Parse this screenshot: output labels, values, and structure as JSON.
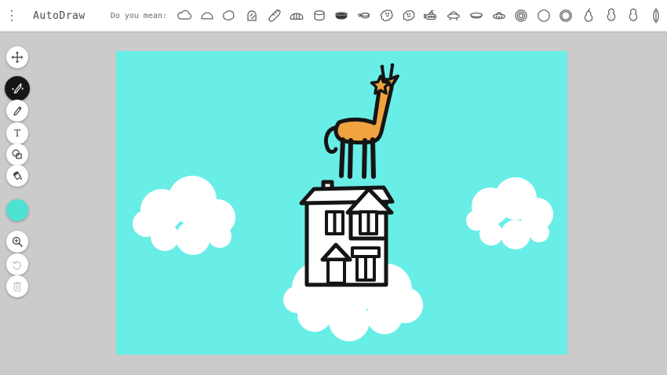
{
  "colors": {
    "topbar_bg": "#FFFFFF",
    "app_bg": "#CBCBCB",
    "canvas": "#69EDE7",
    "outline": "#151515",
    "giraffe": "#F1A33F",
    "cloud": "#FFFFFF",
    "swatch": "#4DE3D2",
    "icon": "#3F3F3F",
    "icon_disabled": "#C4C4C4",
    "suggestion_icon": "#5C5C5C"
  },
  "topbar": {
    "title": "AutoDraw",
    "prompt": "Do you mean:",
    "suggestions": [
      "cloud",
      "cloud-dome",
      "cloud-blob",
      "toast",
      "baguette",
      "bread-roll",
      "cylinder",
      "pot",
      "pan",
      "scribble-creature",
      "scribble-creature-2",
      "submarine",
      "ufo",
      "flying-saucer",
      "spaceship",
      "donut",
      "circle",
      "ring",
      "pear",
      "peanut",
      "peanut-outline",
      "surfboard"
    ]
  },
  "sidebar": {
    "tools": [
      {
        "id": "select",
        "icon": "move-icon"
      },
      {
        "id": "autodraw",
        "icon": "magic-pencil-icon",
        "selected": true
      },
      {
        "id": "draw",
        "icon": "pencil-icon"
      },
      {
        "id": "type",
        "icon": "text-icon"
      },
      {
        "id": "shape",
        "icon": "shapes-icon"
      },
      {
        "id": "fill",
        "icon": "fill-icon"
      },
      {
        "id": "color",
        "icon": "color-swatch"
      },
      {
        "id": "zoom",
        "icon": "magnifier-icon"
      },
      {
        "id": "undo",
        "icon": "undo-icon",
        "disabled": true
      },
      {
        "id": "delete",
        "icon": "trash-icon",
        "disabled": true
      }
    ]
  },
  "canvas": {
    "scene_objects": [
      "giraffe",
      "house",
      "cloud-left",
      "cloud-right",
      "cloud-center"
    ]
  }
}
